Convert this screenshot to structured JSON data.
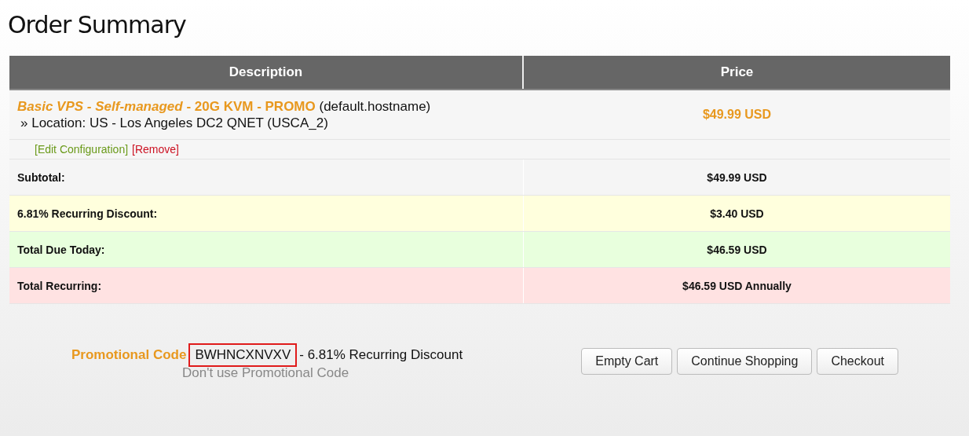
{
  "title": "Order Summary",
  "table": {
    "columns": [
      "Description",
      "Price"
    ],
    "item": {
      "product": "*Basic VPS - Self-managed* - 20G KVM - PROMO",
      "hostname": "(default.hostname)",
      "location": "» Location: US - Los Angeles DC2 QNET (USCA_2)",
      "price": "$49.99 USD",
      "actions": [
        {
          "label": "[Edit Configuration]",
          "kind": "edit"
        },
        {
          "label": "[Remove]",
          "kind": "remove"
        }
      ]
    },
    "summary": [
      {
        "label": "Subtotal:",
        "value": "$49.99 USD",
        "color": "#f5f5f5"
      },
      {
        "label": "6.81% Recurring Discount:",
        "value": "$3.40 USD",
        "color": "#ffffdd"
      },
      {
        "label": "Total Due Today:",
        "value": "$46.59 USD",
        "color": "#e8ffdd"
      },
      {
        "label": "Total Recurring:",
        "value": "$46.59 USD Annually",
        "color": "#ffe2e2"
      }
    ]
  },
  "promo": {
    "label": "Promotional Code",
    "code": "BWHNCXNVXV",
    "description": "- 6.81% Recurring Discount",
    "remove_link": "Don't use Promotional Code"
  },
  "buttons": [
    "Empty Cart",
    "Continue Shopping",
    "Checkout"
  ]
}
